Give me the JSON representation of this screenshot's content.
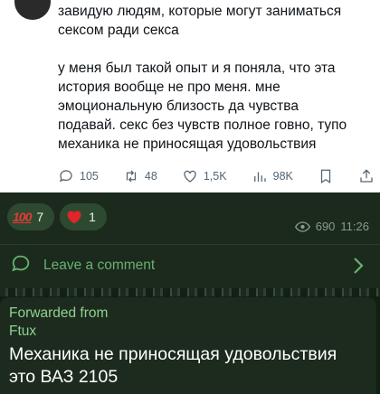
{
  "tweet": {
    "paragraph_1": "завидую людям, которые могут заниматься\nсексом ради секса",
    "paragraph_2": "у меня был такой опыт и я поняла, что эта\nистория вообще не про меня. мне\nэмоциональную близость да чувства\nподавай. секс без чувств полное говно, тупо\nмеханика не приносящая удовольствия",
    "actions": {
      "replies": "105",
      "retweets": "48",
      "likes": "1,5K",
      "views": "98K"
    }
  },
  "post": {
    "reactions": [
      {
        "icon": "hundred-points-icon",
        "count": "7"
      },
      {
        "icon": "heart-icon",
        "count": "1"
      }
    ],
    "views": "690",
    "time": "11:26",
    "comment_label": "Leave a comment"
  },
  "forwarded": {
    "label": "Forwarded from",
    "name": "Ftux",
    "text": "Механика не приносящая удовольствия\nэто ВАЗ 2105"
  },
  "colors": {
    "accent": "#6ab06f",
    "forward_name": "#8fd18f",
    "background": "#0f1f12"
  }
}
